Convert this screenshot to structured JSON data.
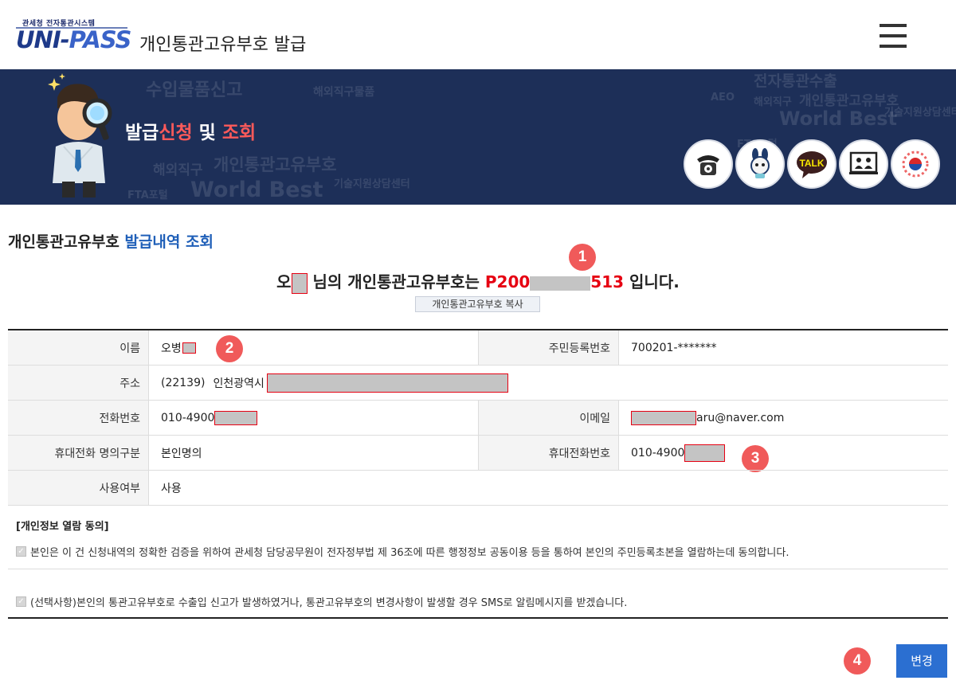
{
  "header": {
    "logo_top": "관세청 전자통관시스템",
    "logo_text_left": "UNI-",
    "logo_text_right": "PASS",
    "title": "개인통관고유부호 발급",
    "menu_icon": "hamburger-icon"
  },
  "banner": {
    "title_part1": "발급",
    "title_part2": "신청",
    "title_part3": " 및 ",
    "title_part4": "조회",
    "watermark": [
      "수입물품신고",
      "해외직구물품",
      "전자통관수출",
      "해외직구",
      "개인통관고유부호",
      "World Best",
      "FTA포털",
      "AEO",
      "기술지원상담센터",
      "해외직구",
      "개인통관고유부호",
      "World Best",
      "기술지원상담센터",
      "FTA포털"
    ],
    "icons": [
      {
        "name": "telephone-icon"
      },
      {
        "name": "chatbot-rabbit-icon"
      },
      {
        "name": "kakao-talk-icon",
        "label": "TALK"
      },
      {
        "name": "video-consult-icon"
      },
      {
        "name": "government-emblem-icon"
      }
    ]
  },
  "section": {
    "title_part1": "개인통관고유부호 ",
    "title_part2": "발급내역 조회"
  },
  "result": {
    "name_prefix": "오",
    "name_suffix": "님의 개인통관고유부호는",
    "code_prefix": "P200",
    "code_suffix": "513",
    "ending": "입니다.",
    "copy_button": "개인통관고유부호 복사"
  },
  "badges": [
    "1",
    "2",
    "3",
    "4"
  ],
  "table": {
    "name_label": "이름",
    "name_value": "오병",
    "rrn_label": "주민등록번호",
    "rrn_value": "700201-*******",
    "address_label": "주소",
    "address_zip": "(22139)",
    "address_city": "인천광역시",
    "phone_label": "전화번호",
    "phone_value": "010-4900",
    "email_label": "이메일",
    "email_value": "aru@naver.com",
    "mobile_owner_label": "휴대전화 명의구분",
    "mobile_owner_value": "본인명의",
    "mobile_label": "휴대전화번호",
    "mobile_value": "010-4900",
    "usage_label": "사용여부",
    "usage_value": "사용"
  },
  "consent": {
    "title": "[개인정보 열람 동의]",
    "item1": "본인은 이 건 신청내역의 정확한 검증을 위하여 관세청 담당공무원이 전자정부법 제 36조에 따른 행정정보 공동이용 등을 통하여 본인의 주민등록초본을 열람하는데 동의합니다.",
    "item2": "(선택사항)본인의 통관고유부호로 수출입 신고가 발생하였거나, 통관고유부호의 변경사항이 발생할 경우 SMS로 알림메시지를 받겠습니다."
  },
  "actions": {
    "change_button": "변경"
  },
  "colors": {
    "banner_bg": "#1d2f58",
    "accent_red": "#e60012",
    "accent_blue": "#1f5fb8",
    "button_blue": "#2b6fd1",
    "badge_red": "#f05a5a"
  }
}
